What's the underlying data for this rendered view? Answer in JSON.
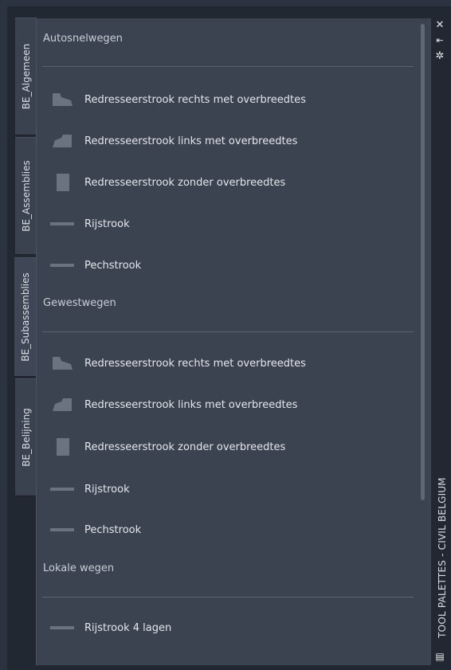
{
  "tabs": [
    {
      "label": "BE_Algemeen",
      "active": false
    },
    {
      "label": "BE_Assemblies",
      "active": false
    },
    {
      "label": "BE_Subassemblies",
      "active": true
    },
    {
      "label": "BE_Belijning",
      "active": false
    }
  ],
  "palette_title": "TOOL PALETTES - CIVIL BELGIUM",
  "sections": [
    {
      "title": "Autosnelwegen",
      "items": [
        {
          "label": "Redresseerstrook rechts met overbreedtes",
          "icon": "slope-right-icon"
        },
        {
          "label": "Redresseerstrook links met overbreedtes",
          "icon": "slope-left-icon"
        },
        {
          "label": "Redresseerstrook zonder overbreedtes",
          "icon": "block-icon"
        },
        {
          "label": "Rijstrook",
          "icon": "lane-icon"
        },
        {
          "label": "Pechstrook",
          "icon": "lane-icon"
        }
      ]
    },
    {
      "title": "Gewestwegen",
      "items": [
        {
          "label": "Redresseerstrook rechts met overbreedtes",
          "icon": "slope-right-icon"
        },
        {
          "label": "Redresseerstrook links met overbreedtes",
          "icon": "slope-left-icon"
        },
        {
          "label": "Redresseerstrook zonder overbreedtes",
          "icon": "block-icon"
        },
        {
          "label": "Rijstrook",
          "icon": "lane-icon"
        },
        {
          "label": "Pechstrook",
          "icon": "lane-icon"
        }
      ]
    },
    {
      "title": "Lokale wegen",
      "items": [
        {
          "label": "Rijstrook 4 lagen",
          "icon": "lane-icon"
        }
      ]
    }
  ],
  "controls": {
    "close": "✕",
    "autohide": "⇤",
    "properties": "✲",
    "menu": "▤"
  },
  "colors": {
    "panel": "#3b4351",
    "tab": "#3a4250",
    "text": "#e4e7ec"
  }
}
